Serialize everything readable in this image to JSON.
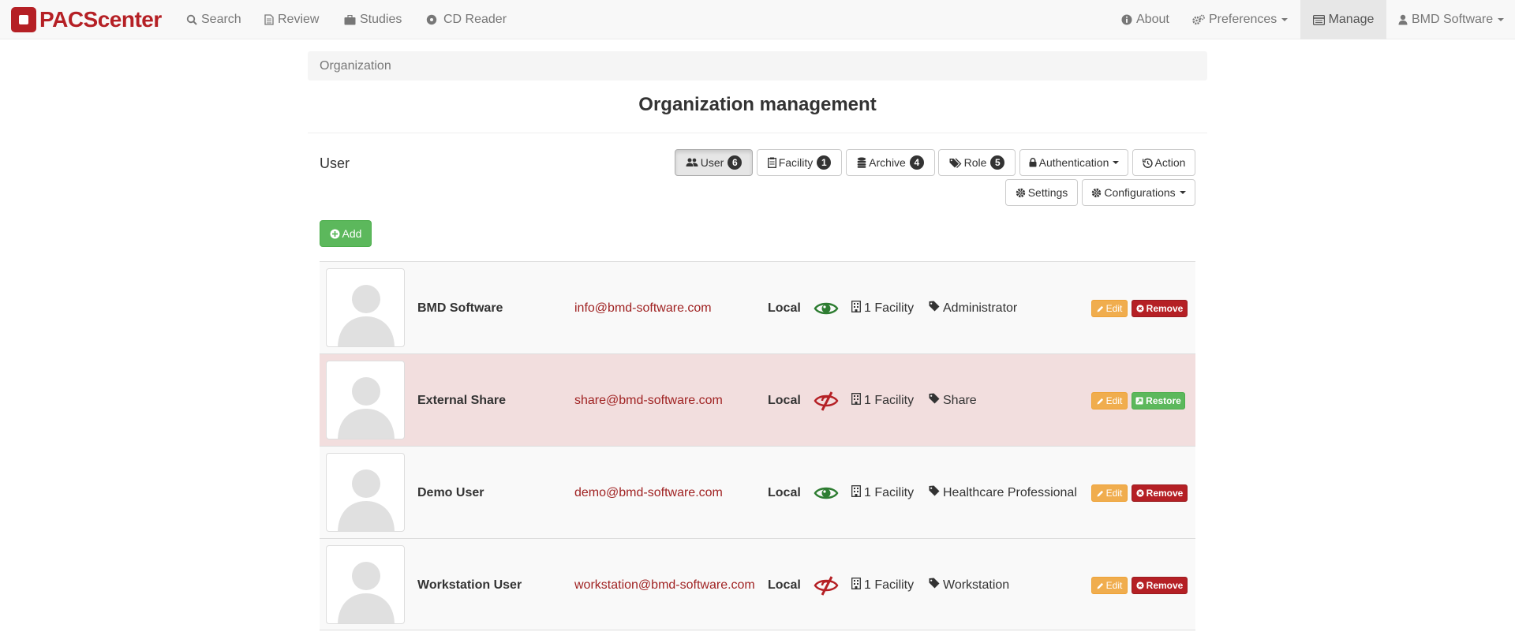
{
  "navbar": {
    "brand": "PACScenter",
    "left_items": [
      {
        "label": "Search",
        "icon": "search-icon"
      },
      {
        "label": "Review",
        "icon": "file-icon"
      },
      {
        "label": "Studies",
        "icon": "briefcase-icon"
      },
      {
        "label": "CD Reader",
        "icon": "disc-icon"
      }
    ],
    "right_items": [
      {
        "label": "About",
        "icon": "info-icon"
      },
      {
        "label": "Preferences",
        "icon": "cogs-icon"
      },
      {
        "label": "Manage",
        "icon": "list-icon",
        "active": true
      },
      {
        "label": "BMD Software",
        "icon": "user-icon"
      }
    ]
  },
  "breadcrumb": "Organization",
  "page_title": "Organization management",
  "section_label": "User",
  "tabs": [
    {
      "label": "User",
      "count": "6",
      "active": true
    },
    {
      "label": "Facility",
      "count": "1"
    },
    {
      "label": "Archive",
      "count": "4"
    },
    {
      "label": "Role",
      "count": "5"
    },
    {
      "label": "Authentication"
    },
    {
      "label": "Action"
    },
    {
      "label": "Settings"
    },
    {
      "label": "Configurations"
    }
  ],
  "add_label": "Add",
  "users": [
    {
      "name": "BMD Software",
      "email": "info@bmd-software.com",
      "auth": "Local",
      "visible": true,
      "facility": "1 Facility",
      "role": "Administrator",
      "edit": "Edit",
      "action": "Remove",
      "deleted": false
    },
    {
      "name": "External Share",
      "email": "share@bmd-software.com",
      "auth": "Local",
      "visible": false,
      "facility": "1 Facility",
      "role": "Share",
      "edit": "Edit",
      "action": "Restore",
      "deleted": true
    },
    {
      "name": "Demo User",
      "email": "demo@bmd-software.com",
      "auth": "Local",
      "visible": true,
      "facility": "1 Facility",
      "role": "Healthcare Professional",
      "edit": "Edit",
      "action": "Remove",
      "deleted": false
    },
    {
      "name": "Workstation User",
      "email": "workstation@bmd-software.com",
      "auth": "Local",
      "visible": false,
      "facility": "1 Facility",
      "role": "Workstation",
      "edit": "Edit",
      "action": "Remove",
      "deleted": false
    }
  ],
  "colors": {
    "brand": "#b52025",
    "success": "#5cb85c",
    "warning": "#f0ad4e",
    "danger": "#b52025",
    "eye_green": "#2e7d32",
    "eye_red": "#b52025"
  }
}
